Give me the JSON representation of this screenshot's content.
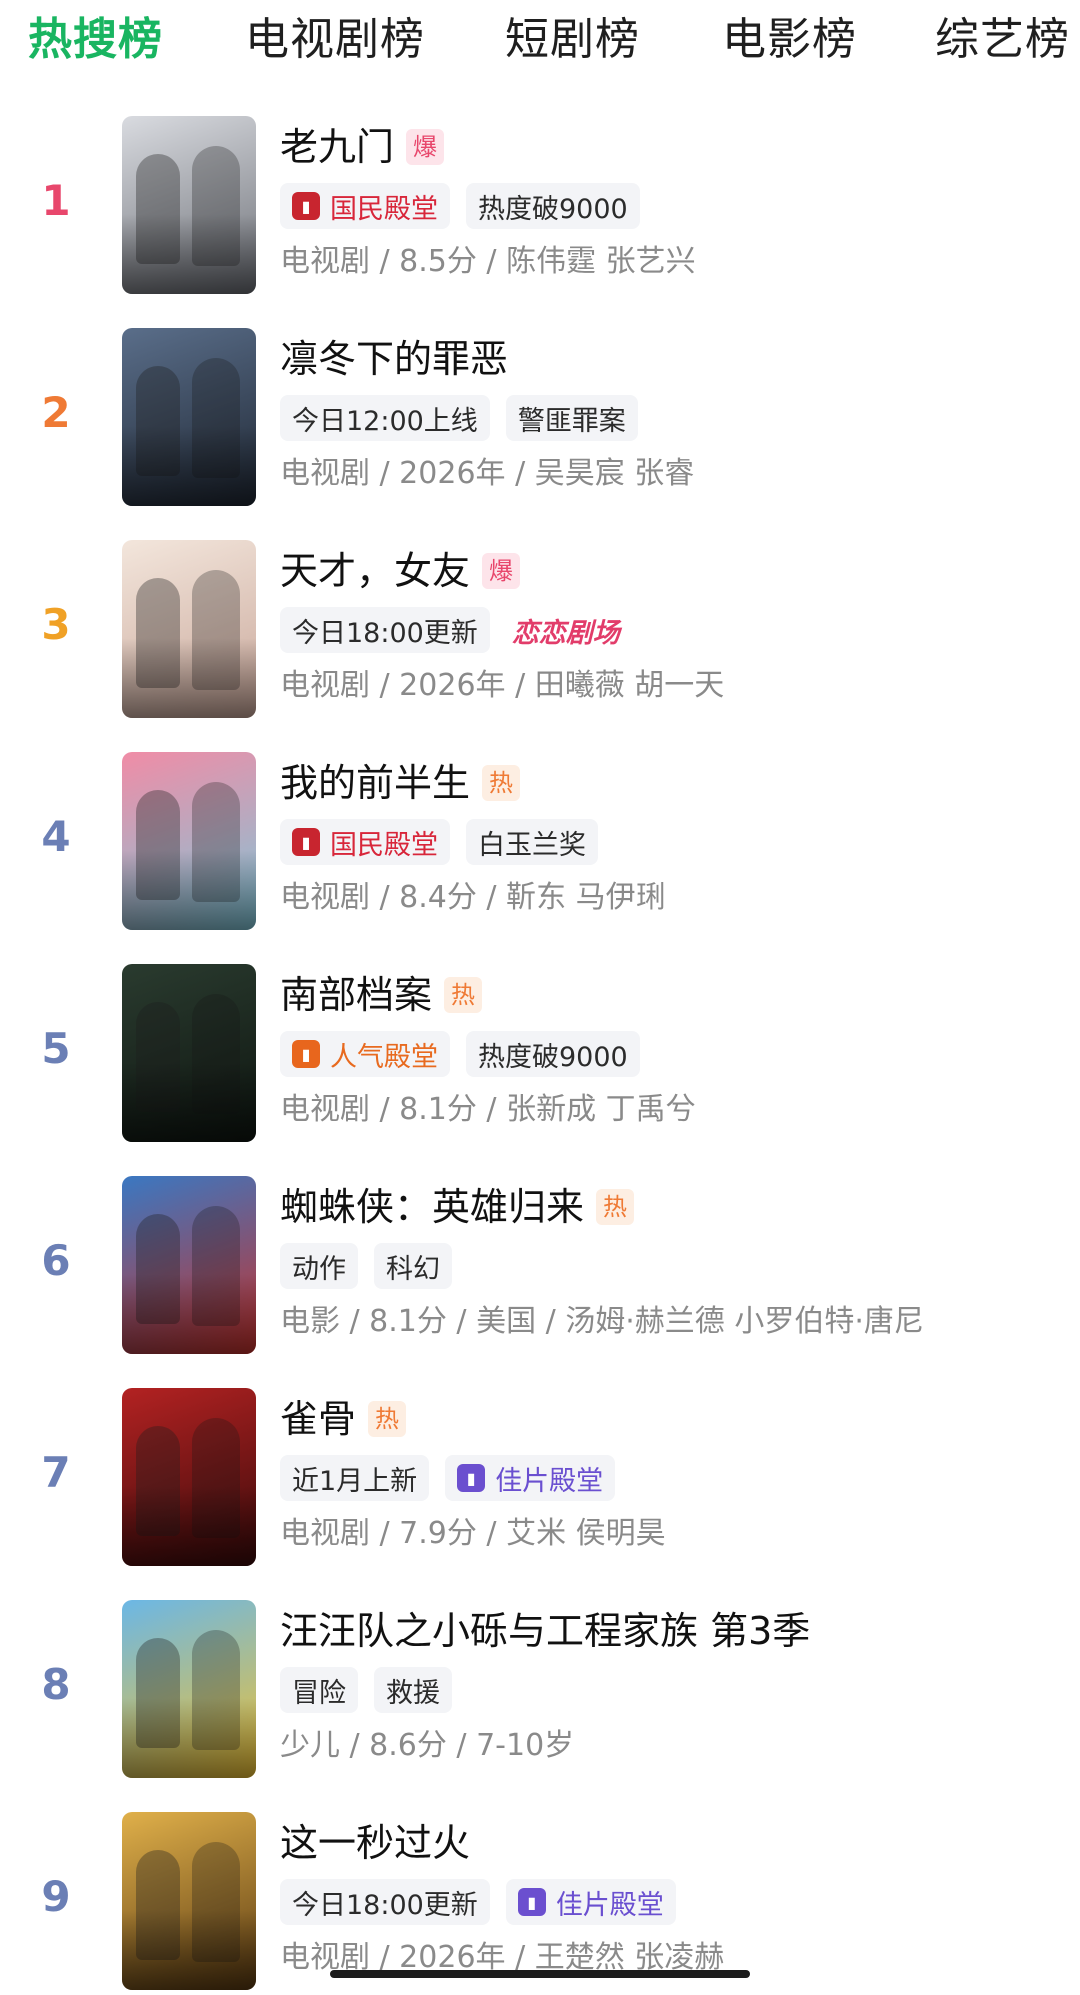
{
  "tabs": [
    {
      "label": "热搜榜",
      "active": true
    },
    {
      "label": "电视剧榜",
      "active": false
    },
    {
      "label": "短剧榜",
      "active": false
    },
    {
      "label": "电影榜",
      "active": false
    },
    {
      "label": "综艺榜",
      "active": false
    }
  ],
  "colors": {
    "accent": "#19b561",
    "rank_1": "#e8476c",
    "rank_2": "#ef7a35",
    "rank_3": "#f0a126",
    "rank_other": "#6b7fb5"
  },
  "items": [
    {
      "rank": "1",
      "title": "老九门",
      "badge": "爆",
      "tags": [
        {
          "text": "国民殿堂",
          "style": "red",
          "icon": "hall-badge-icon"
        },
        {
          "text": "热度破9000"
        }
      ],
      "meta": "电视剧 / 8.5分 / 陈伟霆 张艺兴"
    },
    {
      "rank": "2",
      "title": "凛冬下的罪恶",
      "badge": "",
      "tags": [
        {
          "text": "今日12:00上线"
        },
        {
          "text": "警匪罪案"
        }
      ],
      "meta": "电视剧 / 2026年 / 吴昊宸 张睿"
    },
    {
      "rank": "3",
      "title": "天才，女友",
      "badge": "爆",
      "tags": [
        {
          "text": "今日18:00更新"
        },
        {
          "text": "恋恋剧场",
          "style": "pinkbrand"
        }
      ],
      "meta": "电视剧 / 2026年 / 田曦薇 胡一天"
    },
    {
      "rank": "4",
      "title": "我的前半生",
      "badge": "热",
      "tags": [
        {
          "text": "国民殿堂",
          "style": "red",
          "icon": "hall-badge-icon"
        },
        {
          "text": "白玉兰奖"
        }
      ],
      "meta": "电视剧 / 8.4分 / 靳东 马伊琍"
    },
    {
      "rank": "5",
      "title": "南部档案",
      "badge": "热",
      "tags": [
        {
          "text": "人气殿堂",
          "style": "orange",
          "icon": "hall-badge-icon"
        },
        {
          "text": "热度破9000"
        }
      ],
      "meta": "电视剧 / 8.1分 / 张新成 丁禹兮"
    },
    {
      "rank": "6",
      "title": "蜘蛛侠：英雄归来",
      "badge": "热",
      "tags": [
        {
          "text": "动作"
        },
        {
          "text": "科幻"
        }
      ],
      "meta": "电影 / 8.1分 / 美国 / 汤姆·赫兰德 小罗伯特·唐尼"
    },
    {
      "rank": "7",
      "title": "雀骨",
      "badge": "热",
      "tags": [
        {
          "text": "近1月上新"
        },
        {
          "text": "佳片殿堂",
          "style": "purple",
          "icon": "hall-badge-icon"
        }
      ],
      "meta": "电视剧 / 7.9分 / 艾米 侯明昊"
    },
    {
      "rank": "8",
      "title": "汪汪队之小砾与工程家族 第3季",
      "badge": "",
      "tags": [
        {
          "text": "冒险"
        },
        {
          "text": "救援"
        }
      ],
      "meta": "少儿 / 8.6分 / 7-10岁"
    },
    {
      "rank": "9",
      "title": "这一秒过火",
      "badge": "",
      "tags": [
        {
          "text": "今日18:00更新"
        },
        {
          "text": "佳片殿堂",
          "style": "purple",
          "icon": "hall-badge-icon"
        }
      ],
      "meta": "电视剧 / 2026年 / 王楚然 张凌赫"
    }
  ]
}
